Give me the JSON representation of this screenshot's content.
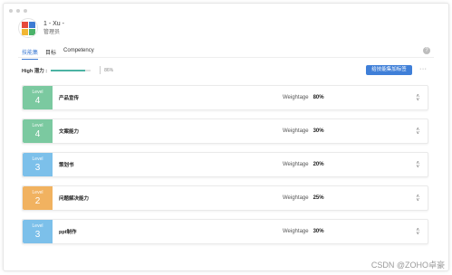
{
  "profile": {
    "name": "1 - Xu -",
    "role": "管理员",
    "avatar_colors": [
      "#e64a3c",
      "#3d7bd3",
      "#f2b632",
      "#4bb36a"
    ]
  },
  "tabs": [
    {
      "label": "技能集",
      "active": true
    },
    {
      "label": "目标",
      "active": false
    },
    {
      "label": "Competency",
      "active": false
    }
  ],
  "help_icon": "?",
  "score": {
    "label": "High 潜力 :",
    "percent_text": "86%",
    "progress": 0.86
  },
  "add_button": {
    "label": "给技能集加标签"
  },
  "more_icon": "···",
  "weightage_label": "Weightage",
  "rows": [
    {
      "level_label": "Level",
      "level": "4",
      "skill": "产品宣传",
      "weight": "80%",
      "color": "#7bc9a0"
    },
    {
      "level_label": "Level",
      "level": "4",
      "skill": "文案能力",
      "weight": "30%",
      "color": "#7bc9a0"
    },
    {
      "level_label": "Level",
      "level": "3",
      "skill": "策划书",
      "weight": "20%",
      "color": "#7cc0ea"
    },
    {
      "level_label": "Level",
      "level": "2",
      "skill": "问题解决能力",
      "weight": "25%",
      "color": "#f1b260"
    },
    {
      "level_label": "Level",
      "level": "3",
      "skill": "ppt制作",
      "weight": "30%",
      "color": "#7cc0ea"
    }
  ],
  "watermark": "CSDN @ZOHO卓豪"
}
